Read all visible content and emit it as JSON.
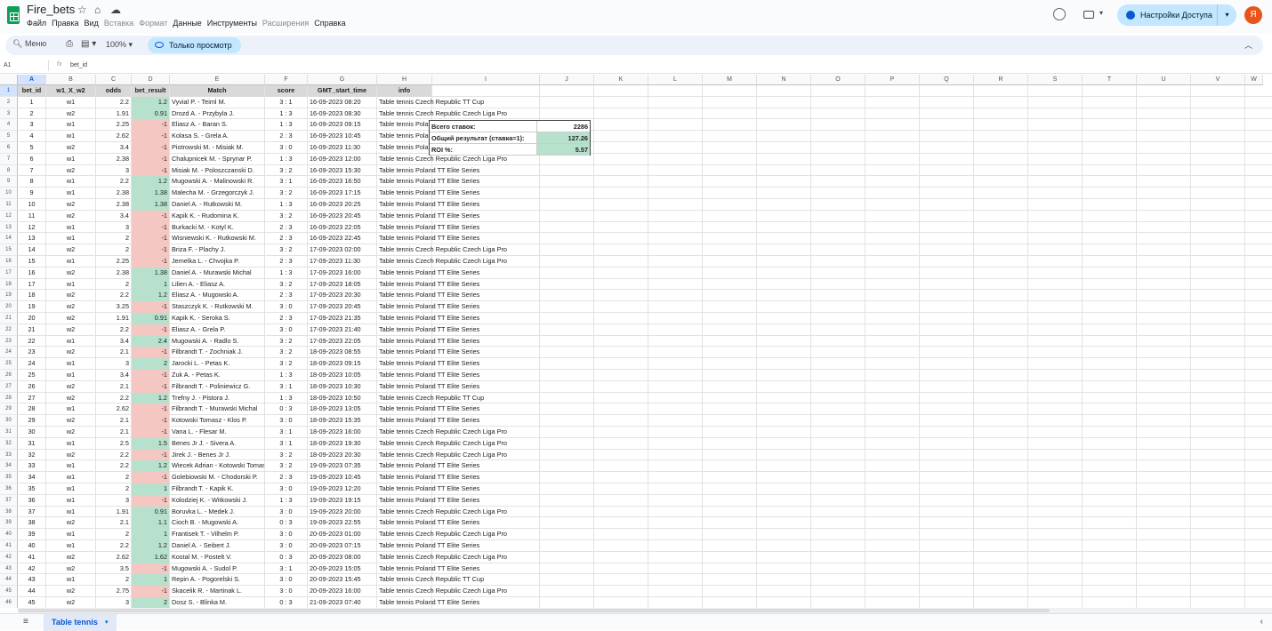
{
  "app": {
    "title": "Fire_bets",
    "menus": [
      "Файл",
      "Правка",
      "Вид",
      "Вставка",
      "Формат",
      "Данные",
      "Инструменты",
      "Расширения",
      "Справка"
    ],
    "disabled_menus": [
      "Вставка",
      "Формат",
      "Расширения"
    ],
    "share_label": "Настройки Доступа",
    "avatar_letter": "Я"
  },
  "toolbar": {
    "search_label": "Меню",
    "zoom": "100%",
    "view_only": "Только просмотр"
  },
  "formula_bar": {
    "cell_ref": "A1",
    "fx": "fx",
    "value": "bet_id"
  },
  "columns": [
    "A",
    "B",
    "C",
    "D",
    "E",
    "F",
    "G",
    "H",
    "I",
    "J",
    "K",
    "L",
    "M",
    "N",
    "O",
    "P",
    "Q",
    "R",
    "S",
    "T",
    "U",
    "V",
    "W"
  ],
  "header_row": [
    "bet_id",
    "w1_X_w2",
    "odds",
    "bet_result",
    "Match",
    "score",
    "GMT_start_time",
    "info"
  ],
  "rows": [
    [
      "1",
      "w1",
      "2.2",
      "1.2",
      "Vyvial P. - Teiml M.",
      "3 : 1",
      "16-09-2023 08:20",
      "Table tennis Czech Republic TT Cup"
    ],
    [
      "2",
      "w2",
      "1.91",
      "0.91",
      "Drozd A. - Przybyla J.",
      "1 : 3",
      "16-09-2023 08:30",
      "Table tennis Czech Republic Czech Liga Pro"
    ],
    [
      "3",
      "w1",
      "2.25",
      "-1",
      "Eliasz A. - Baran S.",
      "1 : 3",
      "16-09-2023 09:15",
      "Table tennis Poland TT Elite Series"
    ],
    [
      "4",
      "w1",
      "2.62",
      "-1",
      "Kolasa S. - Grela A.",
      "2 : 3",
      "16-09-2023 10:45",
      "Table tennis Poland TT Elite Series"
    ],
    [
      "5",
      "w2",
      "3.4",
      "-1",
      "Piotrowski M. - Misiak M.",
      "3 : 0",
      "16-09-2023 11:30",
      "Table tennis Poland TT Elite Series"
    ],
    [
      "6",
      "w1",
      "2.38",
      "-1",
      "Chalupnicek M. - Sprynar P.",
      "1 : 3",
      "16-09-2023 12:00",
      "Table tennis Czech Republic Czech Liga Pro"
    ],
    [
      "7",
      "w2",
      "3",
      "-1",
      "Misiak M. - Poloszczanski D.",
      "3 : 2",
      "16-09-2023 15:30",
      "Table tennis Poland TT Elite Series"
    ],
    [
      "8",
      "w1",
      "2.2",
      "1.2",
      "Mugowski A. - Malinowski R.",
      "3 : 1",
      "16-09-2023 16:50",
      "Table tennis Poland TT Elite Series"
    ],
    [
      "9",
      "w1",
      "2.38",
      "1.38",
      "Malecha M. - Grzegorczyk J.",
      "3 : 2",
      "16-09-2023 17:15",
      "Table tennis Poland TT Elite Series"
    ],
    [
      "10",
      "w2",
      "2.38",
      "1.38",
      "Daniel A. - Rutkowski M.",
      "1 : 3",
      "16-09-2023 20:25",
      "Table tennis Poland TT Elite Series"
    ],
    [
      "11",
      "w2",
      "3.4",
      "-1",
      "Kapik K. - Rudomina K.",
      "3 : 2",
      "16-09-2023 20:45",
      "Table tennis Poland TT Elite Series"
    ],
    [
      "12",
      "w1",
      "3",
      "-1",
      "Burkacki M. - Kotyl K.",
      "2 : 3",
      "16-09-2023 22:05",
      "Table tennis Poland TT Elite Series"
    ],
    [
      "13",
      "w1",
      "2",
      "-1",
      "Wisniewski K. - Rutkowski M.",
      "2 : 3",
      "16-09-2023 22:45",
      "Table tennis Poland TT Elite Series"
    ],
    [
      "14",
      "w2",
      "2",
      "-1",
      "Briza F. - Plachy J.",
      "3 : 2",
      "17-09-2023 02:00",
      "Table tennis Czech Republic Czech Liga Pro"
    ],
    [
      "15",
      "w1",
      "2.25",
      "-1",
      "Jemelka L. - Chvojka P.",
      "2 : 3",
      "17-09-2023 11:30",
      "Table tennis Czech Republic Czech Liga Pro"
    ],
    [
      "16",
      "w2",
      "2.38",
      "1.38",
      "Daniel A. - Murawski Michal",
      "1 : 3",
      "17-09-2023 16:00",
      "Table tennis Poland TT Elite Series"
    ],
    [
      "17",
      "w1",
      "2",
      "1",
      "Lilien A. - Eliasz A.",
      "3 : 2",
      "17-09-2023 18:05",
      "Table tennis Poland TT Elite Series"
    ],
    [
      "18",
      "w2",
      "2.2",
      "1.2",
      "Eliasz A. - Mugowski A.",
      "2 : 3",
      "17-09-2023 20:30",
      "Table tennis Poland TT Elite Series"
    ],
    [
      "19",
      "w2",
      "3.25",
      "-1",
      "Staszczyk K. - Rutkowski M.",
      "3 : 0",
      "17-09-2023 20:45",
      "Table tennis Poland TT Elite Series"
    ],
    [
      "20",
      "w2",
      "1.91",
      "0.91",
      "Kapik K. - Seroka S.",
      "2 : 3",
      "17-09-2023 21:35",
      "Table tennis Poland TT Elite Series"
    ],
    [
      "21",
      "w2",
      "2.2",
      "-1",
      "Eliasz A. - Grela P.",
      "3 : 0",
      "17-09-2023 21:40",
      "Table tennis Poland TT Elite Series"
    ],
    [
      "22",
      "w1",
      "3.4",
      "2.4",
      "Mugowski A. - Radlo S.",
      "3 : 2",
      "17-09-2023 22:05",
      "Table tennis Poland TT Elite Series"
    ],
    [
      "23",
      "w2",
      "2.1",
      "-1",
      "Filbrandt T. - Zochniak J.",
      "3 : 2",
      "18-09-2023 08:55",
      "Table tennis Poland TT Elite Series"
    ],
    [
      "24",
      "w1",
      "3",
      "2",
      "Jarocki L. - Petas K.",
      "3 : 2",
      "18-09-2023 09:15",
      "Table tennis Poland TT Elite Series"
    ],
    [
      "25",
      "w1",
      "3.4",
      "-1",
      "Zuk A. - Petas K.",
      "1 : 3",
      "18-09-2023 10:05",
      "Table tennis Poland TT Elite Series"
    ],
    [
      "26",
      "w2",
      "2.1",
      "-1",
      "Filbrandt T. - Poliniewicz G.",
      "3 : 1",
      "18-09-2023 10:30",
      "Table tennis Poland TT Elite Series"
    ],
    [
      "27",
      "w2",
      "2.2",
      "1.2",
      "Trefny J. - Pistora J.",
      "1 : 3",
      "18-09-2023 10:50",
      "Table tennis Czech Republic TT Cup"
    ],
    [
      "28",
      "w1",
      "2.62",
      "-1",
      "Filbrandt T. - Murawski Michal",
      "0 : 3",
      "18-09-2023 13:05",
      "Table tennis Poland TT Elite Series"
    ],
    [
      "29",
      "w2",
      "2.1",
      "-1",
      "Kotowski Tomasz - Klos P.",
      "3 : 0",
      "18-09-2023 15:35",
      "Table tennis Poland TT Elite Series"
    ],
    [
      "30",
      "w2",
      "2.1",
      "-1",
      "Vana L. - Flesar M.",
      "3 : 1",
      "18-09-2023 16:00",
      "Table tennis Czech Republic Czech Liga Pro"
    ],
    [
      "31",
      "w1",
      "2.5",
      "1.5",
      "Benes Jr J. - Sivera A.",
      "3 : 1",
      "18-09-2023 19:30",
      "Table tennis Czech Republic Czech Liga Pro"
    ],
    [
      "32",
      "w2",
      "2.2",
      "-1",
      "Jirek J. - Benes Jr J.",
      "3 : 2",
      "18-09-2023 20:30",
      "Table tennis Czech Republic Czech Liga Pro"
    ],
    [
      "33",
      "w1",
      "2.2",
      "1.2",
      "Wiecek Adrian - Kotowski Tomasz",
      "3 : 2",
      "19-09-2023 07:35",
      "Table tennis Poland TT Elite Series"
    ],
    [
      "34",
      "w1",
      "2",
      "-1",
      "Golebiowski M. - Chodorski P.",
      "2 : 3",
      "19-09-2023 10:45",
      "Table tennis Poland TT Elite Series"
    ],
    [
      "35",
      "w1",
      "2",
      "1",
      "Filbrandt T. - Kapik K.",
      "3 : 0",
      "19-09-2023 12:20",
      "Table tennis Poland TT Elite Series"
    ],
    [
      "36",
      "w1",
      "3",
      "-1",
      "Kolodziej K. - Witkowski J.",
      "1 : 3",
      "19-09-2023 19:15",
      "Table tennis Poland TT Elite Series"
    ],
    [
      "37",
      "w1",
      "1.91",
      "0.91",
      "Boruvka L. - Medek J.",
      "3 : 0",
      "19-09-2023 20:00",
      "Table tennis Czech Republic Czech Liga Pro"
    ],
    [
      "38",
      "w2",
      "2.1",
      "1.1",
      "Cioch B. - Mugowski A.",
      "0 : 3",
      "19-09-2023 22:55",
      "Table tennis Poland TT Elite Series"
    ],
    [
      "39",
      "w1",
      "2",
      "1",
      "Frantisek T. - Vilhelm P.",
      "3 : 0",
      "20-09-2023 01:00",
      "Table tennis Czech Republic Czech Liga Pro"
    ],
    [
      "40",
      "w1",
      "2.2",
      "1.2",
      "Daniel A. - Seibert J.",
      "3 : 0",
      "20-09-2023 07:15",
      "Table tennis Poland TT Elite Series"
    ],
    [
      "41",
      "w2",
      "2.62",
      "1.62",
      "Kostal M. - Postelt V.",
      "0 : 3",
      "20-09-2023 08:00",
      "Table tennis Czech Republic Czech Liga Pro"
    ],
    [
      "42",
      "w2",
      "3.5",
      "-1",
      "Mugowski A. - Sudol P.",
      "3 : 1",
      "20-09-2023 15:05",
      "Table tennis Poland TT Elite Series"
    ],
    [
      "43",
      "w1",
      "2",
      "1",
      "Repin A. - Pogorelski S.",
      "3 : 0",
      "20-09-2023 15:45",
      "Table tennis Czech Republic TT Cup"
    ],
    [
      "44",
      "w2",
      "2.75",
      "-1",
      "Skacelik R. - Martinak L.",
      "3 : 0",
      "20-09-2023 16:00",
      "Table tennis Czech Republic Czech Liga Pro"
    ],
    [
      "45",
      "w2",
      "3",
      "2",
      "Dosz S. - Blinka M.",
      "0 : 3",
      "21-09-2023 07:40",
      "Table tennis Poland TT Elite Series"
    ]
  ],
  "summary": [
    {
      "label": "Всего ставок:",
      "value": "2286"
    },
    {
      "label": "Общий результат (ставка=1):",
      "value": "127.26"
    },
    {
      "label": "ROI %:",
      "value": "5.57"
    }
  ],
  "sheet_tab": "Table tennis",
  "colors": {
    "positive": "#b7e1cd",
    "negative": "#f4c7c3",
    "header": "#d9d9d9",
    "accent": "#0b57d0"
  }
}
